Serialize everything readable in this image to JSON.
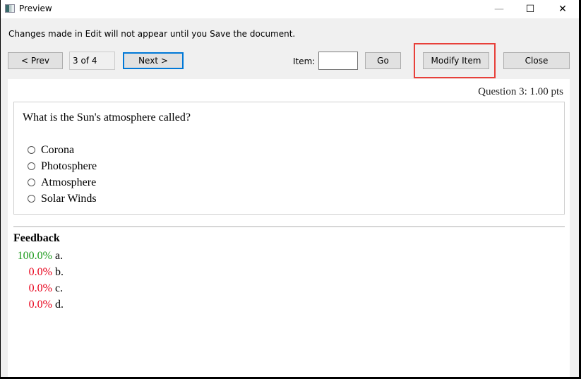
{
  "window": {
    "title": "Preview",
    "icon": "app-window-icon",
    "controls": {
      "minimize": "—",
      "maximize": "☐",
      "close": "✕"
    }
  },
  "toolbar": {
    "notice": "Changes made in Edit will not appear until you Save the document.",
    "prev_label": "< Prev",
    "page_indicator": "3 of 4",
    "next_label": "Next  >",
    "item_label": "Item:",
    "item_value": "",
    "go_label": "Go",
    "modify_label": "Modify Item",
    "close_label": "Close",
    "highlight_color": "#e8403a"
  },
  "question": {
    "points": "Question 3: 1.00 pts",
    "text": "What is the Sun's atmosphere called?",
    "choices": [
      {
        "label": "Corona"
      },
      {
        "label": "Photosphere"
      },
      {
        "label": "Atmosphere"
      },
      {
        "label": "Solar Winds"
      }
    ]
  },
  "feedback": {
    "title": "Feedback",
    "rows": [
      {
        "percent": "100.0%",
        "letter": "a.",
        "color": "#1a9a1a"
      },
      {
        "percent": "0.0%",
        "letter": "b.",
        "color": "#e8001a"
      },
      {
        "percent": "0.0%",
        "letter": "c.",
        "color": "#e8001a"
      },
      {
        "percent": "0.0%",
        "letter": "d.",
        "color": "#e8001a"
      }
    ]
  }
}
